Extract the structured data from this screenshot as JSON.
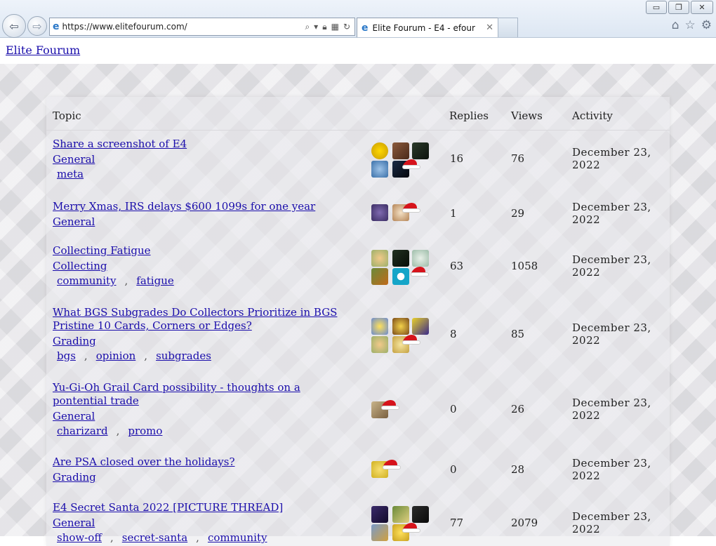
{
  "browser": {
    "address_url": "https://www.elitefourum.com/",
    "tab_title": "Elite Fourum - E4 - efour",
    "window_controls": [
      "minimize-icon",
      "restore-icon",
      "close-icon"
    ],
    "toolbar_icons": [
      "home-icon",
      "favorites-star-icon",
      "settings-gear-icon"
    ]
  },
  "site": {
    "title": "Elite Fourum"
  },
  "table": {
    "headers": {
      "topic": "Topic",
      "replies": "Replies",
      "views": "Views",
      "activity": "Activity"
    },
    "rows": [
      {
        "title": "Share a screenshot of E4",
        "category": "General",
        "tags": [
          "meta"
        ],
        "replies": "16",
        "views": "76",
        "activity": "December 23, 2022"
      },
      {
        "title": "Merry Xmas, IRS delays $600 1099s for one year",
        "category": "General",
        "tags": [],
        "replies": "1",
        "views": "29",
        "activity": "December 23, 2022"
      },
      {
        "title": "Collecting Fatigue",
        "category": "Collecting",
        "tags": [
          "community",
          "fatigue"
        ],
        "replies": "63",
        "views": "1058",
        "activity": "December 23, 2022"
      },
      {
        "title": "What BGS Subgrades Do Collectors Prioritize in BGS Pristine 10 Cards, Corners or Edges?",
        "category": "Grading",
        "tags": [
          "bgs",
          "opinion",
          "subgrades"
        ],
        "replies": "8",
        "views": "85",
        "activity": "December 23, 2022"
      },
      {
        "title": "Yu-Gi-Oh Grail Card possibility - thoughts on a pontential trade",
        "category": "General",
        "tags": [
          "charizard",
          "promo"
        ],
        "replies": "0",
        "views": "26",
        "activity": "December 23, 2022"
      },
      {
        "title": "Are PSA closed over the holidays?",
        "category": "Grading",
        "tags": [],
        "replies": "0",
        "views": "28",
        "activity": "December 23, 2022"
      },
      {
        "title": "E4 Secret Santa 2022 [PICTURE THREAD]",
        "category": "General",
        "tags": [
          "show-off",
          "secret-santa",
          "community"
        ],
        "replies": "77",
        "views": "2079",
        "activity": "December 23, 2022"
      }
    ]
  },
  "colors": {
    "link": "#1a0dab",
    "santa_red": "#d6131b"
  }
}
